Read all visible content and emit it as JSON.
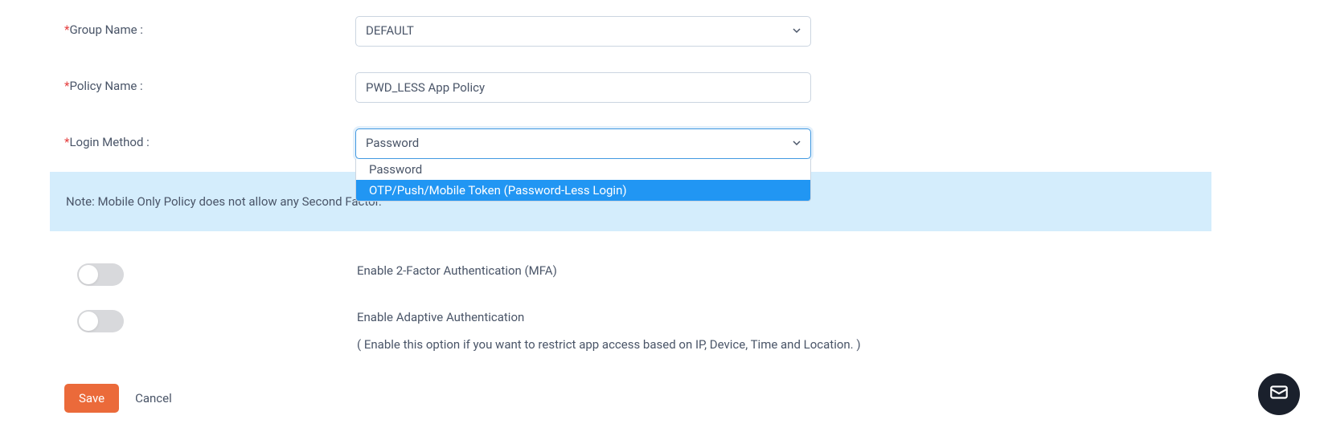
{
  "form": {
    "groupName": {
      "label": "Group Name :",
      "value": "DEFAULT"
    },
    "policyName": {
      "label": "Policy Name :",
      "value": "PWD_LESS App Policy"
    },
    "loginMethod": {
      "label": "Login Method :",
      "value": "Password",
      "options": [
        "Password",
        "OTP/Push/Mobile Token (Password-Less Login)"
      ]
    }
  },
  "note": "Note: Mobile Only Policy does not allow any Second Factor.",
  "toggles": {
    "mfa": {
      "label": "Enable 2-Factor Authentication (MFA)",
      "enabled": false
    },
    "adaptive": {
      "label": "Enable Adaptive Authentication",
      "sublabel": "( Enable this option if you want to restrict app access based on IP, Device, Time and Location. )",
      "enabled": false
    }
  },
  "buttons": {
    "save": "Save",
    "cancel": "Cancel"
  }
}
